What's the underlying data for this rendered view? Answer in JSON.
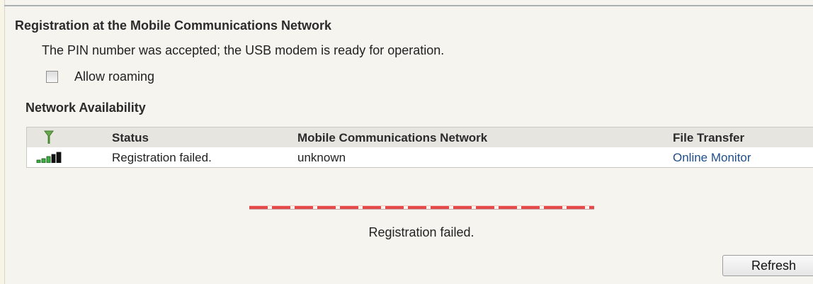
{
  "registration": {
    "title": "Registration at the Mobile Communications Network",
    "message": "The PIN number was accepted; the USB modem is ready for operation.",
    "roaming_label": "Allow roaming",
    "roaming_checked": false
  },
  "network": {
    "title": "Network Availability",
    "header_icon": "antenna-icon",
    "columns": {
      "status": "Status",
      "network": "Mobile Communications Network",
      "transfer": "File Transfer"
    },
    "rows": [
      {
        "signal_icon": "signal-strength-icon",
        "status": "Registration failed.",
        "network": "unknown",
        "transfer_link": "Online Monitor"
      }
    ]
  },
  "error": {
    "color": "#e44a4a",
    "message": "Registration failed."
  },
  "actions": {
    "refresh_label": "Refresh"
  },
  "colors": {
    "background": "#f5f4ef",
    "header_row": "#e6e5e0",
    "link": "#1f4e8c"
  }
}
